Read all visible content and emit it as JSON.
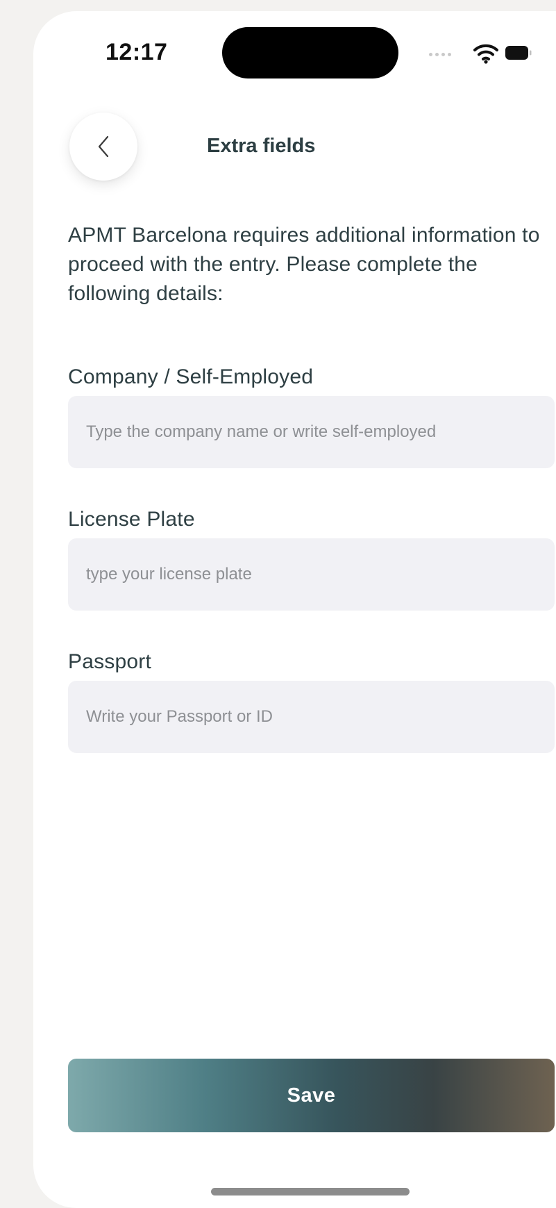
{
  "status_bar": {
    "time": "12:17"
  },
  "header": {
    "title": "Extra fields",
    "back_icon": "chevron-left-icon"
  },
  "intro_text": "APMT Barcelona requires additional information to proceed with the entry. Please complete the following details:",
  "fields": [
    {
      "label": "Company / Self-Employed",
      "value": "",
      "placeholder": "Type the company name or write self-employed"
    },
    {
      "label": "License Plate",
      "value": "",
      "placeholder": "type your license plate"
    },
    {
      "label": "Passport",
      "value": "",
      "placeholder": "Write your Passport or ID"
    }
  ],
  "save_button": {
    "label": "Save"
  },
  "colors": {
    "text": "#2e3f43",
    "input_background": "#f1f1f5",
    "button_gradient_start": "#7ea9ab",
    "button_gradient_end": "#6e6251"
  }
}
